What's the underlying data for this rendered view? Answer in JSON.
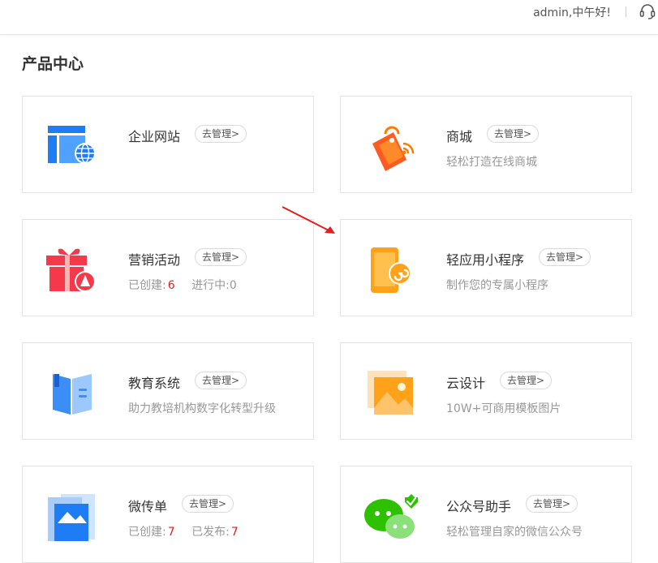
{
  "header": {
    "greeting": "admin,中午好!"
  },
  "section": {
    "title": "产品中心"
  },
  "manage_label": "去管理>",
  "cards": {
    "website": {
      "name": "企业网站",
      "desc": ""
    },
    "mall": {
      "name": "商城",
      "desc": "轻松打造在线商城"
    },
    "marketing": {
      "name": "营销活动",
      "created_label": "已创建:",
      "created_count": "6",
      "ongoing_label": "进行中:",
      "ongoing_count": "0"
    },
    "miniprogram": {
      "name": "轻应用小程序",
      "desc": "制作您的专属小程序"
    },
    "education": {
      "name": "教育系统",
      "desc": "助力教培机构数字化转型升级"
    },
    "clouddesign": {
      "name": "云设计",
      "desc": "10W+可商用模板图片"
    },
    "weflyer": {
      "name": "微传单",
      "created_label": "已创建:",
      "created_count": "7",
      "published_label": "已发布:",
      "published_count": "7"
    },
    "official": {
      "name": "公众号助手",
      "desc": "轻松管理自家的微信公众号"
    }
  },
  "colors": {
    "accent_red": "#e02020",
    "website_blue": "#1e7cf5",
    "mall_orange": "#ff6a00",
    "marketing_red": "#f5394a",
    "mini_orange": "#ffa21a",
    "edu_blue": "#3a8ef6",
    "wechat_green": "#2dc100"
  }
}
